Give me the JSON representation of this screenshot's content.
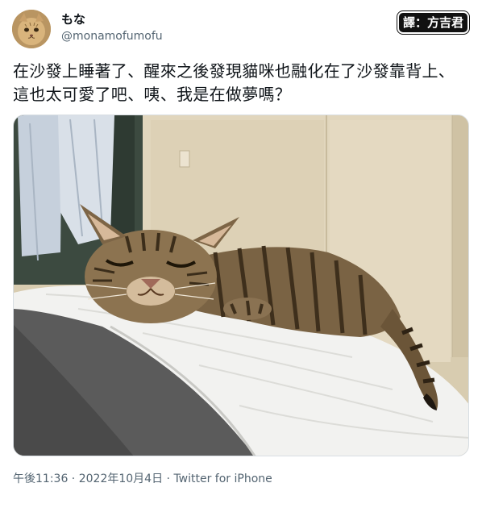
{
  "tweet": {
    "author": {
      "display_name": "もな",
      "handle": "@monamofumofu",
      "avatar_icon": "cat-avatar-icon"
    },
    "translator_badge": "譯：方吉君",
    "text": "在沙發上睡著了、醒來之後發現貓咪也融化在了沙發靠背上、這也太可愛了吧、咦、我是在做夢嗎？",
    "media": {
      "icon": "sleeping-cat-photo"
    },
    "meta": {
      "time": "午後11:36",
      "separator1": " · ",
      "date": "2022年10月4日",
      "separator2": " · ",
      "source": "Twitter for iPhone"
    }
  },
  "colors": {
    "text_primary": "#0f1419",
    "text_secondary": "#536471",
    "border": "#d8dee3"
  }
}
